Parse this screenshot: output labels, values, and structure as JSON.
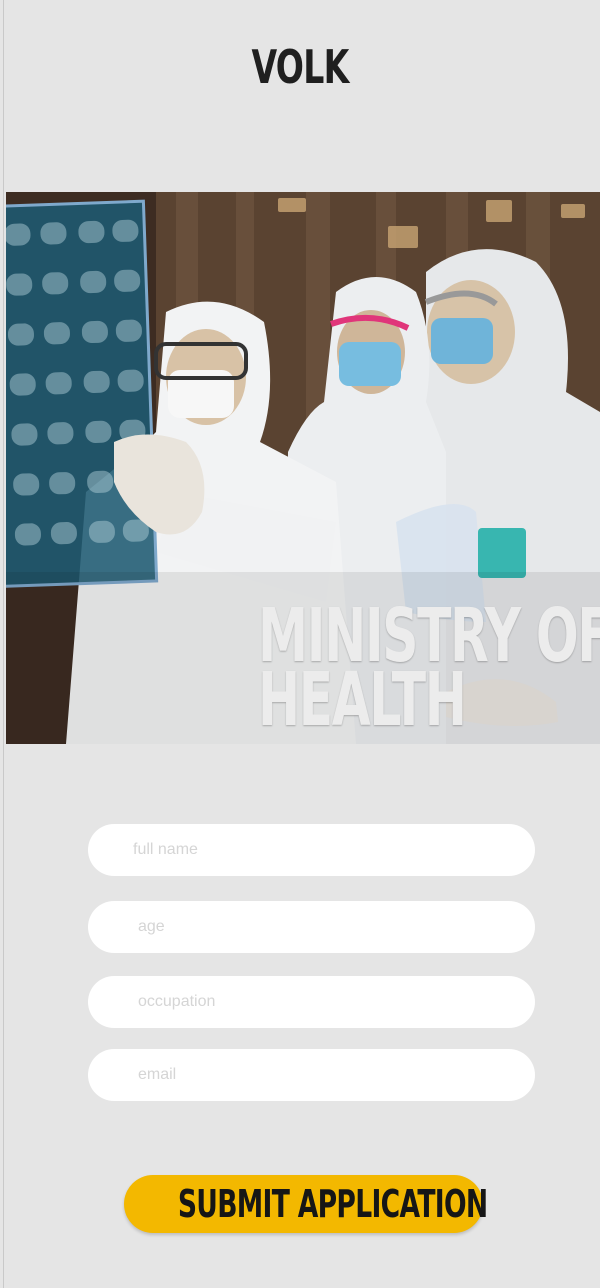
{
  "header": {
    "brand": "VOLK"
  },
  "hero": {
    "title_line1": "MINISTRY OF",
    "title_line2": "HEALTH",
    "image_subject": "medical-workers-in-protective-suits-reviewing-xray"
  },
  "form": {
    "fields": [
      {
        "placeholder": "full name",
        "value": ""
      },
      {
        "placeholder": "age",
        "value": ""
      },
      {
        "placeholder": "occupation",
        "value": ""
      },
      {
        "placeholder": "email",
        "value": ""
      }
    ],
    "submit_label": "SUBMIT APPLICATION"
  },
  "colors": {
    "background": "#e5e5e5",
    "accent": "#f3b800",
    "field": "#ffffff",
    "placeholder": "#d5d5d5",
    "text_dark": "#1f1f1f"
  }
}
